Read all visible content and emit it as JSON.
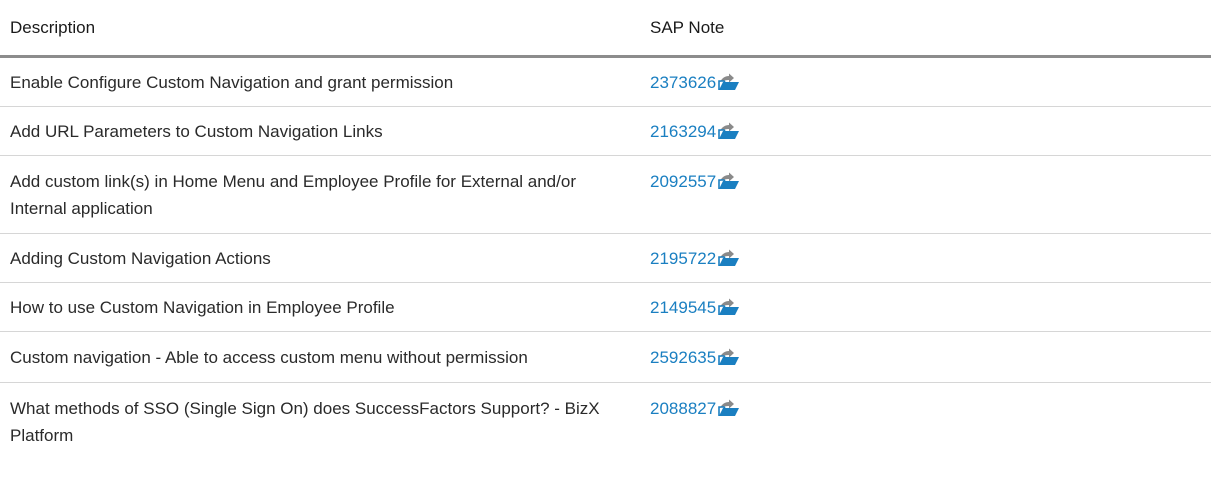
{
  "table": {
    "headers": {
      "description": "Description",
      "sap_note": "SAP Note"
    },
    "rows": [
      {
        "description": "Enable Configure Custom Navigation and grant permission",
        "note": "2373626"
      },
      {
        "description": "Add URL Parameters to Custom Navigation Links",
        "note": "2163294"
      },
      {
        "description": "Add custom link(s) in Home Menu and Employee Profile for External and/or Internal application",
        "note": "2092557"
      },
      {
        "description": "Adding Custom Navigation Actions",
        "note": "2195722"
      },
      {
        "description": "How to use Custom Navigation in Employee Profile",
        "note": "2149545"
      },
      {
        "description": "Custom navigation - Able to access custom menu without permission",
        "note": "2592635"
      },
      {
        "description": "What methods of SSO (Single Sign On) does SuccessFactors Support? - BizX Platform",
        "note": "2088827"
      }
    ],
    "link_icon": "external-document-icon",
    "colors": {
      "link": "#1a7fc1",
      "header_rule": "#8c8c8c",
      "row_rule": "#d6d6d6",
      "icon_folder": "#1a7fc1",
      "icon_arrow": "#8a8a8a"
    }
  }
}
